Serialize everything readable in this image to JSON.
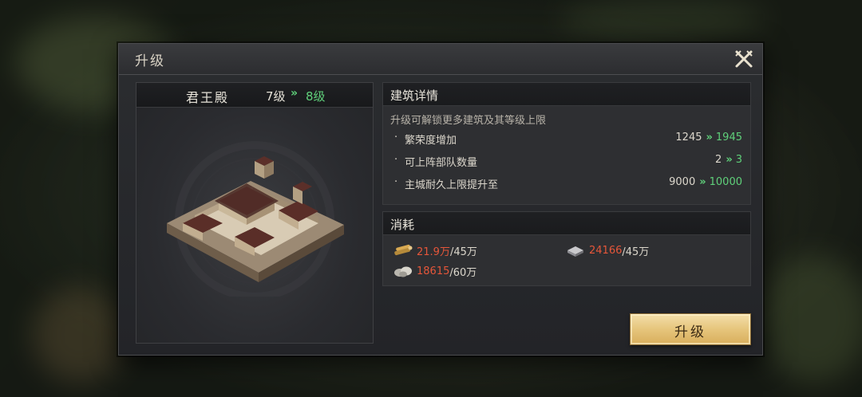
{
  "dialog": {
    "title": "升级"
  },
  "building": {
    "name": "君王殿",
    "level_from": "7级",
    "level_arrow": "»",
    "level_to": "8级"
  },
  "details": {
    "title": "建筑详情",
    "description": "升级可解锁更多建筑及其等级上限",
    "rows": [
      {
        "bullet": "·",
        "label": "繁荣度增加",
        "from": "1245",
        "arrow": "»",
        "to": "1945"
      },
      {
        "bullet": "·",
        "label": "可上阵部队数量",
        "from": "2",
        "arrow": "»",
        "to": "3"
      },
      {
        "bullet": "·",
        "label": "主城耐久上限提升至",
        "from": "9000",
        "arrow": "»",
        "to": "10000"
      }
    ]
  },
  "cost": {
    "title": "消耗",
    "items": [
      {
        "icon": "wood-icon",
        "current": "21.9万",
        "max": "/45万"
      },
      {
        "icon": "iron-icon",
        "current": "24166",
        "max": "/45万"
      },
      {
        "icon": "stone-icon",
        "current": "18615",
        "max": "/60万"
      }
    ]
  },
  "actions": {
    "upgrade_label": "升级"
  },
  "colors": {
    "increase": "#5fd07a",
    "insufficient": "#e5563a",
    "button_gold": "#e6c57c"
  }
}
